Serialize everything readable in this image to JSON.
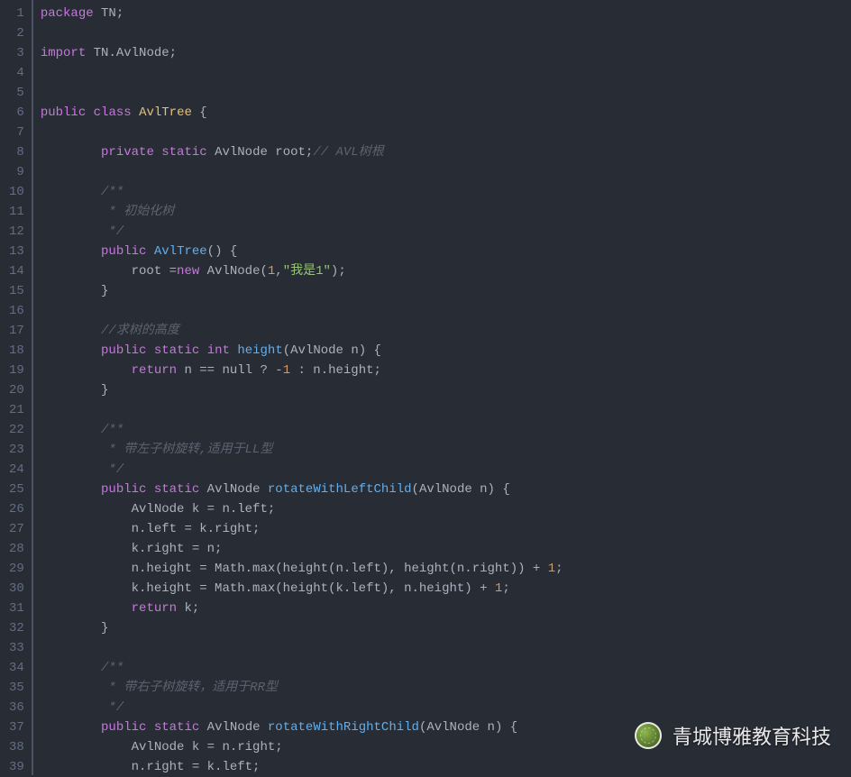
{
  "watermark": {
    "text": "青城博雅教育科技"
  },
  "lines": [
    {
      "n": 1,
      "frags": [
        {
          "cls": "kw-pkg",
          "t": "package"
        },
        {
          "cls": "punc",
          "t": " "
        },
        {
          "cls": "type",
          "t": "TN"
        },
        {
          "cls": "punc",
          "t": ";"
        }
      ]
    },
    {
      "n": 2,
      "frags": []
    },
    {
      "n": 3,
      "frags": [
        {
          "cls": "kw-pkg",
          "t": "import"
        },
        {
          "cls": "punc",
          "t": " "
        },
        {
          "cls": "type",
          "t": "TN.AvlNode"
        },
        {
          "cls": "punc",
          "t": ";"
        }
      ]
    },
    {
      "n": 4,
      "frags": []
    },
    {
      "n": 5,
      "frags": []
    },
    {
      "n": 6,
      "frags": [
        {
          "cls": "kw-mod",
          "t": "public"
        },
        {
          "cls": "punc",
          "t": " "
        },
        {
          "cls": "kw-class",
          "t": "class"
        },
        {
          "cls": "punc",
          "t": " "
        },
        {
          "cls": "classname",
          "t": "AvlTree"
        },
        {
          "cls": "punc",
          "t": " {"
        }
      ]
    },
    {
      "n": 7,
      "frags": []
    },
    {
      "n": 8,
      "frags": [
        {
          "cls": "punc",
          "t": "        "
        },
        {
          "cls": "kw-mod",
          "t": "private"
        },
        {
          "cls": "punc",
          "t": " "
        },
        {
          "cls": "kw-mod",
          "t": "static"
        },
        {
          "cls": "punc",
          "t": " "
        },
        {
          "cls": "type",
          "t": "AvlNode root"
        },
        {
          "cls": "punc",
          "t": ";"
        },
        {
          "cls": "comment",
          "t": "// AVL树根"
        }
      ]
    },
    {
      "n": 9,
      "frags": []
    },
    {
      "n": 10,
      "frags": [
        {
          "cls": "punc",
          "t": "        "
        },
        {
          "cls": "comment",
          "t": "/**"
        }
      ]
    },
    {
      "n": 11,
      "frags": [
        {
          "cls": "punc",
          "t": "        "
        },
        {
          "cls": "comment",
          "t": " * 初始化树"
        }
      ]
    },
    {
      "n": 12,
      "frags": [
        {
          "cls": "punc",
          "t": "        "
        },
        {
          "cls": "comment",
          "t": " */"
        }
      ]
    },
    {
      "n": 13,
      "frags": [
        {
          "cls": "punc",
          "t": "        "
        },
        {
          "cls": "kw-mod",
          "t": "public"
        },
        {
          "cls": "punc",
          "t": " "
        },
        {
          "cls": "method",
          "t": "AvlTree"
        },
        {
          "cls": "punc",
          "t": "() {"
        }
      ]
    },
    {
      "n": 14,
      "frags": [
        {
          "cls": "punc",
          "t": "            root ="
        },
        {
          "cls": "kw-new",
          "t": "new"
        },
        {
          "cls": "punc",
          "t": " AvlNode("
        },
        {
          "cls": "num",
          "t": "1"
        },
        {
          "cls": "punc",
          "t": ","
        },
        {
          "cls": "str",
          "t": "\"我是1\""
        },
        {
          "cls": "punc",
          "t": ");"
        }
      ]
    },
    {
      "n": 15,
      "frags": [
        {
          "cls": "punc",
          "t": "        }"
        }
      ]
    },
    {
      "n": 16,
      "frags": []
    },
    {
      "n": 17,
      "frags": [
        {
          "cls": "punc",
          "t": "        "
        },
        {
          "cls": "comment",
          "t": "//求树的高度"
        }
      ]
    },
    {
      "n": 18,
      "frags": [
        {
          "cls": "punc",
          "t": "        "
        },
        {
          "cls": "kw-mod",
          "t": "public"
        },
        {
          "cls": "punc",
          "t": " "
        },
        {
          "cls": "kw-mod",
          "t": "static"
        },
        {
          "cls": "punc",
          "t": " "
        },
        {
          "cls": "kw-mod",
          "t": "int"
        },
        {
          "cls": "punc",
          "t": " "
        },
        {
          "cls": "method",
          "t": "height"
        },
        {
          "cls": "punc",
          "t": "(AvlNode n) {"
        }
      ]
    },
    {
      "n": 19,
      "frags": [
        {
          "cls": "punc",
          "t": "            "
        },
        {
          "cls": "kw-ret",
          "t": "return"
        },
        {
          "cls": "punc",
          "t": " n == null ? -"
        },
        {
          "cls": "num",
          "t": "1"
        },
        {
          "cls": "punc",
          "t": " : n.height;"
        }
      ]
    },
    {
      "n": 20,
      "frags": [
        {
          "cls": "punc",
          "t": "        }"
        }
      ]
    },
    {
      "n": 21,
      "frags": []
    },
    {
      "n": 22,
      "frags": [
        {
          "cls": "punc",
          "t": "        "
        },
        {
          "cls": "comment",
          "t": "/**"
        }
      ]
    },
    {
      "n": 23,
      "frags": [
        {
          "cls": "punc",
          "t": "        "
        },
        {
          "cls": "comment",
          "t": " * 带左子树旋转,适用于LL型"
        }
      ]
    },
    {
      "n": 24,
      "frags": [
        {
          "cls": "punc",
          "t": "        "
        },
        {
          "cls": "comment",
          "t": " */"
        }
      ]
    },
    {
      "n": 25,
      "frags": [
        {
          "cls": "punc",
          "t": "        "
        },
        {
          "cls": "kw-mod",
          "t": "public"
        },
        {
          "cls": "punc",
          "t": " "
        },
        {
          "cls": "kw-mod",
          "t": "static"
        },
        {
          "cls": "punc",
          "t": " AvlNode "
        },
        {
          "cls": "method",
          "t": "rotateWithLeftChild"
        },
        {
          "cls": "punc",
          "t": "(AvlNode n) {"
        }
      ]
    },
    {
      "n": 26,
      "frags": [
        {
          "cls": "punc",
          "t": "            AvlNode k = n.left;"
        }
      ]
    },
    {
      "n": 27,
      "frags": [
        {
          "cls": "punc",
          "t": "            n.left = k.right;"
        }
      ]
    },
    {
      "n": 28,
      "frags": [
        {
          "cls": "punc",
          "t": "            k.right = n;"
        }
      ]
    },
    {
      "n": 29,
      "frags": [
        {
          "cls": "punc",
          "t": "            n.height = Math.max(height(n.left), height(n.right)) + "
        },
        {
          "cls": "num",
          "t": "1"
        },
        {
          "cls": "punc",
          "t": ";"
        }
      ]
    },
    {
      "n": 30,
      "frags": [
        {
          "cls": "punc",
          "t": "            k.height = Math.max(height(k.left), n.height) + "
        },
        {
          "cls": "num",
          "t": "1"
        },
        {
          "cls": "punc",
          "t": ";"
        }
      ]
    },
    {
      "n": 31,
      "frags": [
        {
          "cls": "punc",
          "t": "            "
        },
        {
          "cls": "kw-ret",
          "t": "return"
        },
        {
          "cls": "punc",
          "t": " k;"
        }
      ]
    },
    {
      "n": 32,
      "frags": [
        {
          "cls": "punc",
          "t": "        }"
        }
      ]
    },
    {
      "n": 33,
      "frags": []
    },
    {
      "n": 34,
      "frags": [
        {
          "cls": "punc",
          "t": "        "
        },
        {
          "cls": "comment",
          "t": "/**"
        }
      ]
    },
    {
      "n": 35,
      "frags": [
        {
          "cls": "punc",
          "t": "        "
        },
        {
          "cls": "comment",
          "t": " * 带右子树旋转，适用于RR型"
        }
      ]
    },
    {
      "n": 36,
      "frags": [
        {
          "cls": "punc",
          "t": "        "
        },
        {
          "cls": "comment",
          "t": " */"
        }
      ]
    },
    {
      "n": 37,
      "frags": [
        {
          "cls": "punc",
          "t": "        "
        },
        {
          "cls": "kw-mod",
          "t": "public"
        },
        {
          "cls": "punc",
          "t": " "
        },
        {
          "cls": "kw-mod",
          "t": "static"
        },
        {
          "cls": "punc",
          "t": " AvlNode "
        },
        {
          "cls": "method",
          "t": "rotateWithRightChild"
        },
        {
          "cls": "punc",
          "t": "(AvlNode n) {"
        }
      ]
    },
    {
      "n": 38,
      "frags": [
        {
          "cls": "punc",
          "t": "            AvlNode k = n.right;"
        }
      ]
    },
    {
      "n": 39,
      "frags": [
        {
          "cls": "punc",
          "t": "            n.right = k.left;"
        }
      ]
    }
  ]
}
